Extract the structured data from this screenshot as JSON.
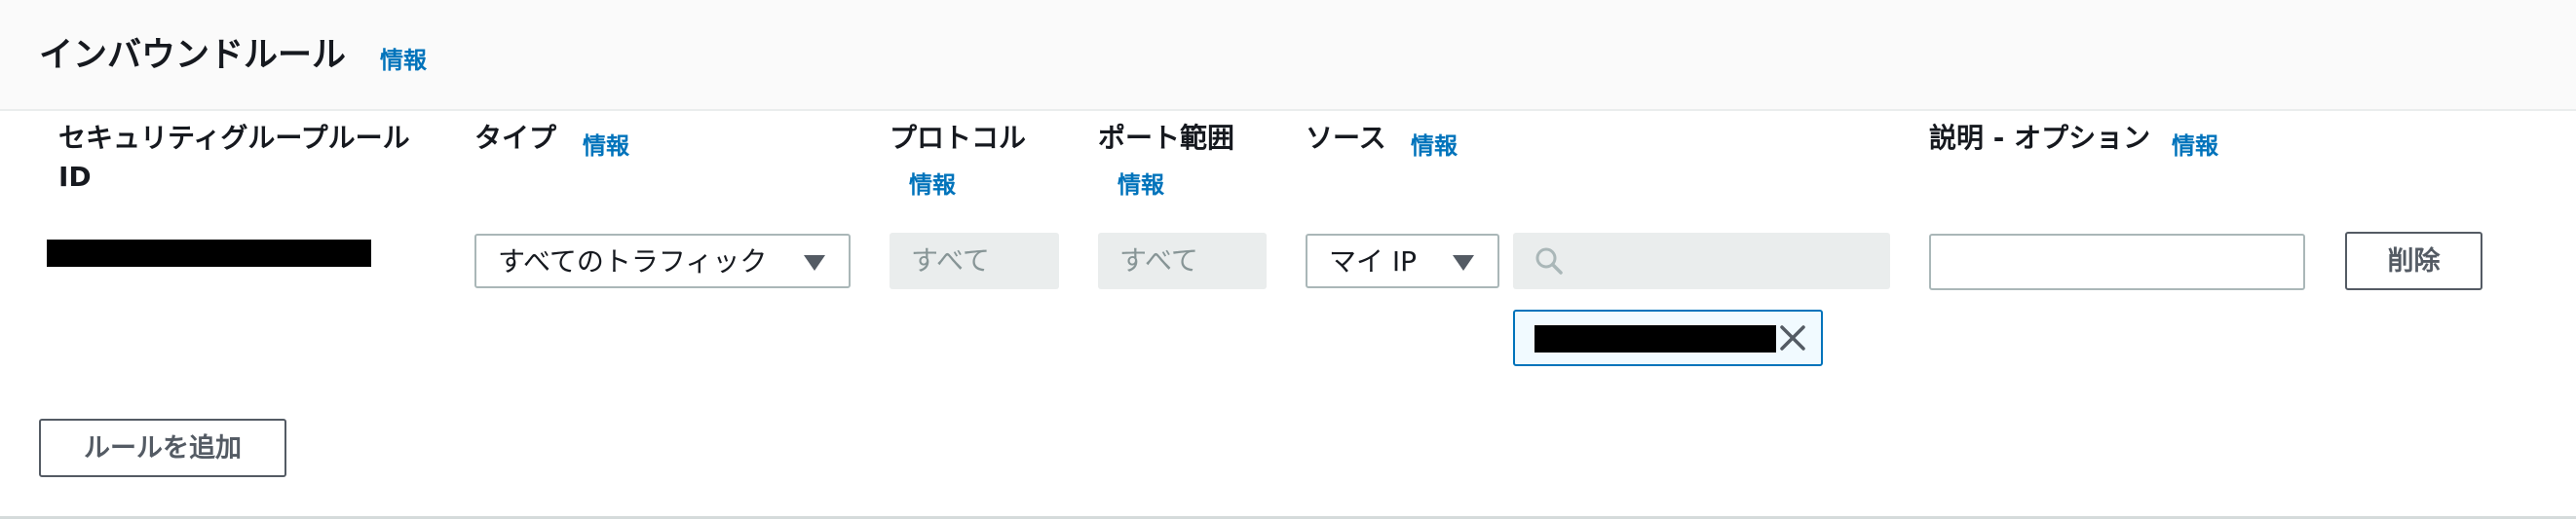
{
  "panel": {
    "title": "インバウンドルール",
    "info_label": "情報"
  },
  "columns": {
    "rule_id": {
      "label_line1": "セキュリティグループルール",
      "label_line2": "ID"
    },
    "type": {
      "label": "タイプ",
      "info": "情報"
    },
    "protocol": {
      "label": "プロトコル",
      "info": "情報"
    },
    "port_range": {
      "label": "ポート範囲",
      "info": "情報"
    },
    "source": {
      "label": "ソース",
      "info": "情報"
    },
    "description": {
      "label": "説明 - オプション",
      "info": "情報"
    }
  },
  "rule": {
    "type_value": "すべてのトラフィック",
    "protocol_value": "すべて",
    "port_value": "すべて",
    "source_type": "マイ IP",
    "source_search_placeholder": "",
    "description_value": "",
    "delete_label": "削除"
  },
  "add_rule_label": "ルールを追加",
  "icons": {
    "search": "search-icon",
    "close": "close-icon",
    "caret": "caret-down-icon"
  },
  "colors": {
    "link": "#0073bb",
    "text": "#16191f",
    "border": "#aab7b8",
    "disabled_bg": "#eaeded",
    "token_border": "#0073bb"
  }
}
